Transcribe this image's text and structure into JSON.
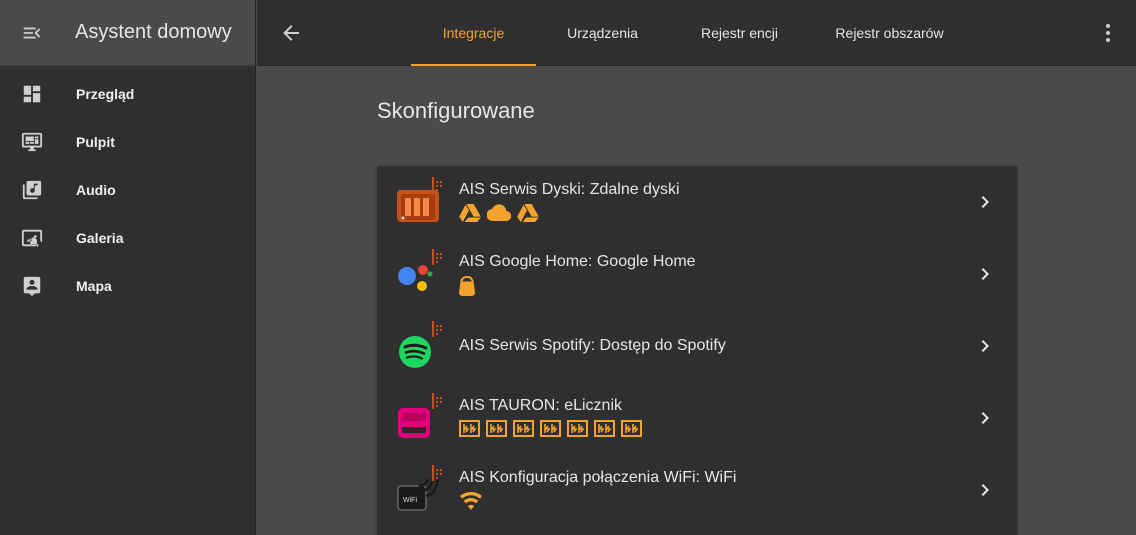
{
  "app": {
    "title": "Asystent domowy"
  },
  "sidebar": {
    "items": [
      {
        "label": "Przegląd",
        "icon": "dashboard-icon"
      },
      {
        "label": "Pulpit",
        "icon": "monitor-dashboard-icon"
      },
      {
        "label": "Audio",
        "icon": "music-library-icon"
      },
      {
        "label": "Galeria",
        "icon": "image-search-icon"
      },
      {
        "label": "Mapa",
        "icon": "account-box-icon"
      }
    ]
  },
  "header": {
    "tabs": [
      {
        "label": "Integracje",
        "active": true
      },
      {
        "label": "Urządzenia",
        "active": false
      },
      {
        "label": "Rejestr encji",
        "active": false
      },
      {
        "label": "Rejestr obszarów",
        "active": false
      }
    ]
  },
  "main": {
    "section_title": "Skonfigurowane",
    "integrations": [
      {
        "title": "AIS Serwis Dyski: Zdalne dyski",
        "logo": "nas-drive-icon",
        "device_icons": [
          "google-drive-icon",
          "cloud-icon",
          "google-drive-icon"
        ]
      },
      {
        "title": "AIS Google Home: Google Home",
        "logo": "google-assistant-icon",
        "device_icons": [
          "google-home-speaker-icon"
        ]
      },
      {
        "title": "AIS Serwis Spotify: Dostęp do Spotify",
        "logo": "spotify-icon",
        "device_icons": []
      },
      {
        "title": "AIS TAURON: eLicznik",
        "logo": "tauron-meter-icon",
        "device_icons": [
          "meter-icon",
          "meter-icon",
          "meter-icon",
          "meter-icon",
          "meter-icon",
          "meter-icon",
          "meter-icon"
        ]
      },
      {
        "title": "AIS Konfiguracja połączenia WiFi: WiFi",
        "logo": "wifi-router-icon",
        "device_icons": [
          "wifi-icon"
        ]
      }
    ]
  },
  "colors": {
    "accent": "#f3a430",
    "sidebar_bg": "#2f2f2f",
    "page_bg": "#4a4a4a",
    "card_bg": "#2f2f2f"
  }
}
